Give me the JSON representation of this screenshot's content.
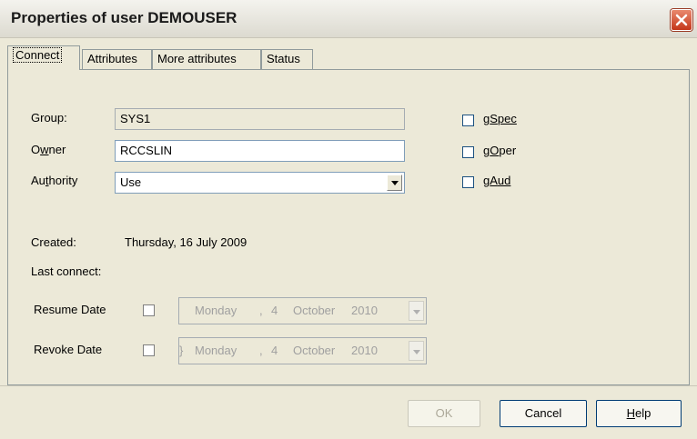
{
  "window": {
    "title": "Properties of user DEMOUSER"
  },
  "tabs": [
    {
      "label": "Connect",
      "active": true
    },
    {
      "label": "Attributes",
      "active": false
    },
    {
      "label": "More attributes",
      "active": false
    },
    {
      "label": "Status",
      "active": false
    }
  ],
  "form": {
    "group_label": "Group:",
    "group_value": "SYS1",
    "owner_label_pre": "O",
    "owner_label_u": "w",
    "owner_label_post": "ner",
    "owner_value": "RCCSLIN",
    "authority_label_pre": "Au",
    "authority_label_u": "t",
    "authority_label_post": "hority",
    "authority_value": "Use",
    "created_label": "Created:",
    "created_value": "Thursday, 16 July 2009",
    "last_connect_label": "Last connect:",
    "resume_label": "Resume Date",
    "revoke_label": "Revoke Date",
    "resume_date": {
      "weekday": "Monday",
      "day": "4",
      "month": "October",
      "year": "2010"
    },
    "revoke_date": {
      "weekday": "Monday",
      "day": "4",
      "month": "October",
      "year": "2010"
    },
    "date_sep": ","
  },
  "options": {
    "gspec": {
      "pre": "g",
      "u": "S",
      "post": "pec",
      "checked": false
    },
    "goper": {
      "pre": "g",
      "u": "O",
      "post": "per",
      "checked": false
    },
    "gaud": {
      "pre": "g",
      "u": "A",
      "post": "ud",
      "checked": false
    }
  },
  "buttons": {
    "ok": "OK",
    "cancel": "Cancel",
    "help_u": "H",
    "help_post": "elp"
  },
  "colors": {
    "titlebar": "#ece9d8",
    "close": "#c4361a",
    "panel": "#ece9d8"
  }
}
